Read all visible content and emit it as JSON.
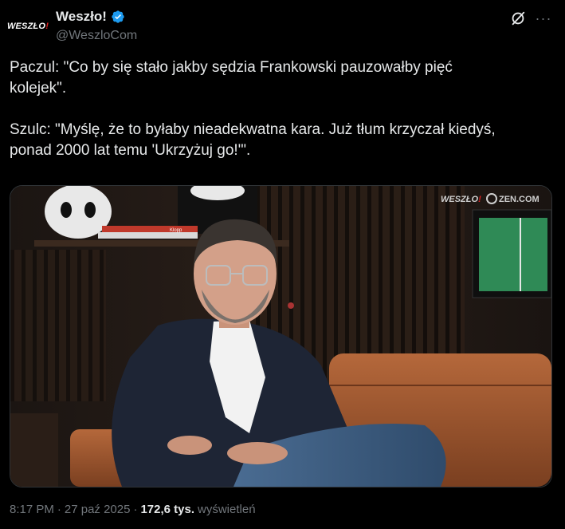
{
  "author": {
    "avatar_text": "WESZŁO",
    "avatar_accent": "!",
    "display_name": "Weszło!",
    "handle": "@WeszloCom",
    "verified": true,
    "verified_color": "#1d9bf0",
    "avatar_icon": "weszlo-logo"
  },
  "actions": {
    "grok_icon": "grok-icon",
    "more_icon": "more-icon",
    "more_label": "···"
  },
  "tweet": {
    "text": "Paczul: \"Co by się stało jakby sędzia Frankowski pauzowałby pięć\nkolejek\".\n\nSzulc: \"Myślę, że to byłaby nieadekwatna kara. Już tłum krzyczał kiedyś,\nponad 2000 lat temu 'Ukrzyżuj go!'\"."
  },
  "media": {
    "watermark_left": "WESZŁO",
    "watermark_accent": "!",
    "watermark_right": "ZEN.COM",
    "book_label": "Klopp"
  },
  "meta": {
    "time": "8:17 PM",
    "separator": "·",
    "date": "27 paź 2025",
    "views_count": "172,6 tys.",
    "views_label": "wyświetleń"
  }
}
